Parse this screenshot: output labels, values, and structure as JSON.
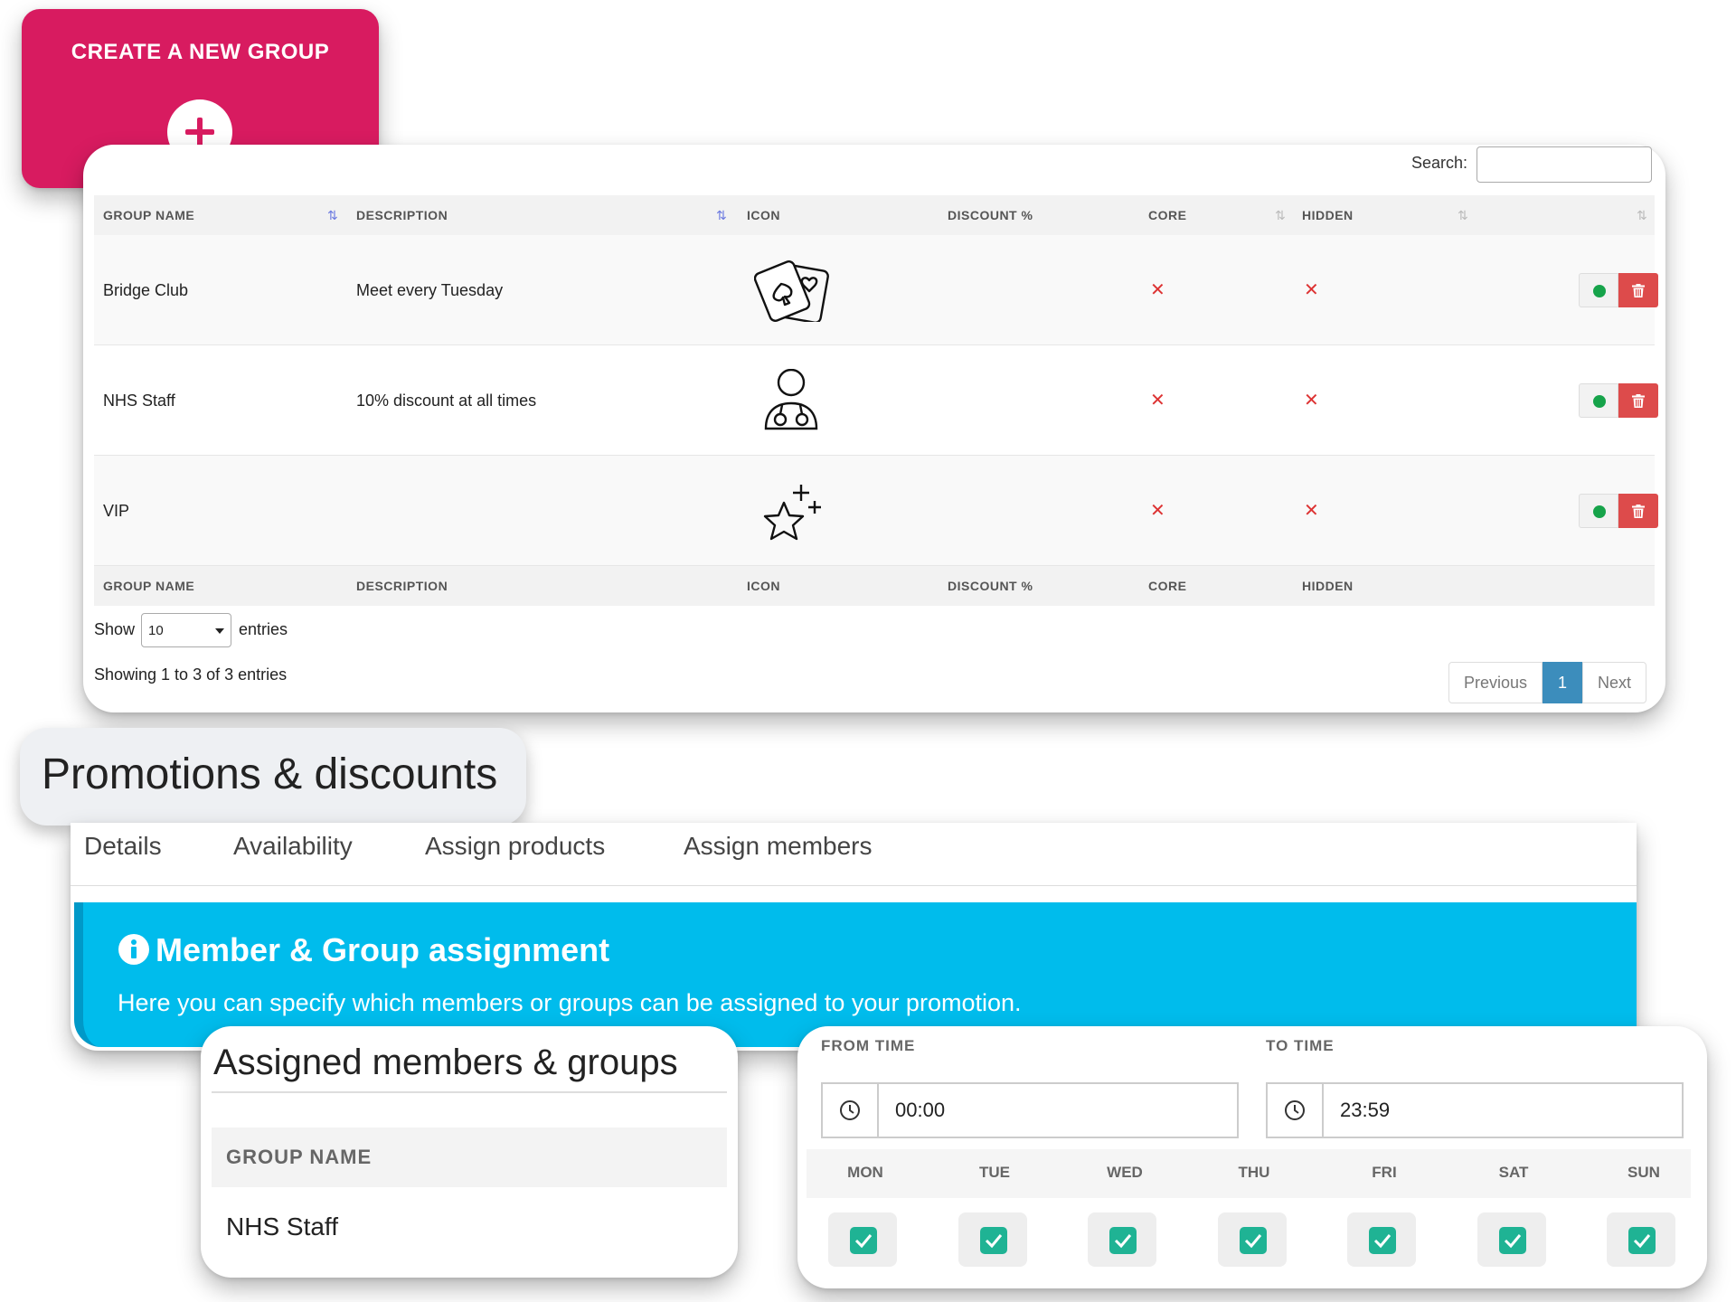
{
  "create_group": {
    "title": "CREATE A NEW GROUP",
    "icon": "plus-icon"
  },
  "groups_table": {
    "search_label": "Search:",
    "search_value": "",
    "columns": [
      "GROUP NAME",
      "DESCRIPTION",
      "ICON",
      "DISCOUNT %",
      "CORE",
      "HIDDEN"
    ],
    "rows": [
      {
        "name": "Bridge Club",
        "description": "Meet every Tuesday",
        "icon": "playing-cards-icon",
        "discount": "",
        "core": "✕",
        "hidden": "✕"
      },
      {
        "name": "NHS Staff",
        "description": "10% discount at all times",
        "icon": "doctor-icon",
        "discount": "",
        "core": "✕",
        "hidden": "✕"
      },
      {
        "name": "VIP",
        "description": "",
        "icon": "star-sparkle-icon",
        "discount": "",
        "core": "✕",
        "hidden": "✕"
      }
    ],
    "show_label": "Show",
    "page_length": "10",
    "entries_label": "entries",
    "info": "Showing 1 to 3 of 3 entries",
    "pagination": {
      "previous": "Previous",
      "current": "1",
      "next": "Next"
    },
    "colors": {
      "status_dot": "#16a34a",
      "delete": "#dd4b4b",
      "x_mark": "#dd3333",
      "active_page": "#3c8dbc"
    }
  },
  "promotions": {
    "title": "Promotions & discounts",
    "tabs": [
      "Details",
      "Availability",
      "Assign products",
      "Assign members"
    ],
    "active_tab": "Assign members",
    "callout": {
      "title": "Member & Group assignment",
      "text": "Here you can specify which members or groups can be assigned to your promotion.",
      "color": "#00bcec"
    }
  },
  "assigned": {
    "title": "Assigned members & groups",
    "column": "GROUP NAME",
    "rows": [
      "NHS Staff"
    ]
  },
  "time": {
    "from_label": "FROM TIME",
    "to_label": "TO TIME",
    "from_value": "00:00",
    "to_value": "23:59",
    "days": [
      "MON",
      "TUE",
      "WED",
      "THU",
      "FRI",
      "SAT",
      "SUN"
    ],
    "days_checked": [
      true,
      true,
      true,
      true,
      true,
      true,
      true
    ],
    "check_color": "#1fb394"
  }
}
